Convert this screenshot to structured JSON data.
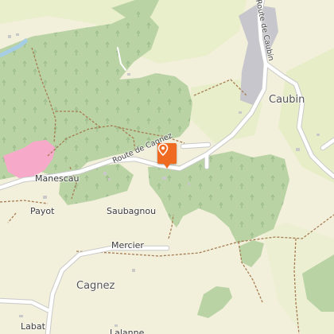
{
  "map": {
    "colors": {
      "background": "#f2efdb",
      "forest": "#b9d3a4",
      "meadow": "#e7edc8",
      "water": "#a5cde6",
      "road": "#ffffff",
      "road_casing": "#c9c9c9",
      "urban": "#c6c6cc",
      "track": "#a67c52",
      "pink_area": "#f7a9c9",
      "marker": "#f06b22"
    },
    "places": {
      "caubin": "Caubin",
      "cagnez": "Cagnez"
    },
    "localities": {
      "manescau": "Manescau",
      "payot": "Payot",
      "saubagnou": "Saubagnou",
      "mercier": "Mercier",
      "labat": "Labat",
      "lalanne": "Lalanne"
    },
    "roads": {
      "route_de_caubin": "Route de Caubin",
      "route_de_cagnez": "Route de Cagnez"
    },
    "marker_icon": "location-pin-icon"
  }
}
